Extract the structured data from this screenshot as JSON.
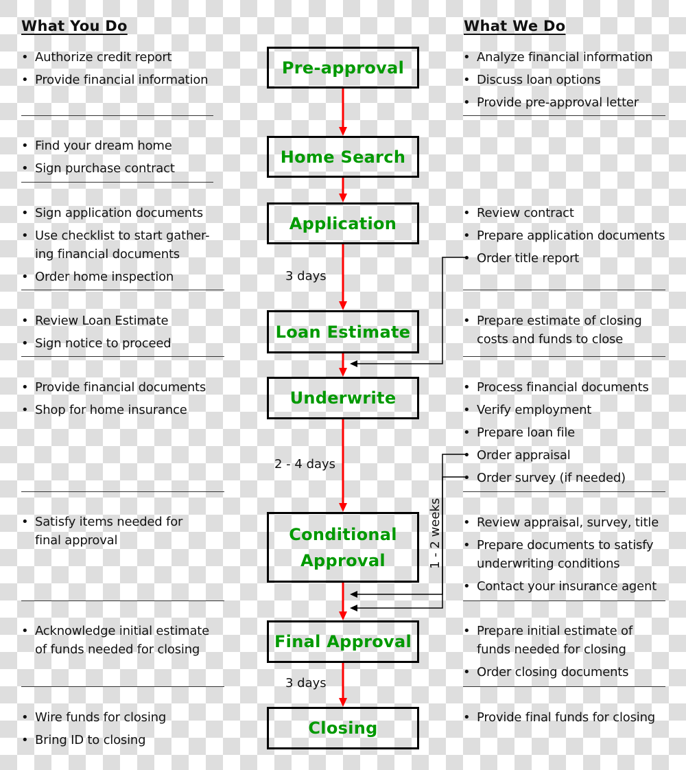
{
  "headings": {
    "you": "What You Do",
    "we": "What We Do"
  },
  "steps": [
    {
      "label": "Pre-approval"
    },
    {
      "label": "Home Search"
    },
    {
      "label": "Application"
    },
    {
      "label": "Loan Estimate"
    },
    {
      "label": "Underwrite"
    },
    {
      "label": "Conditional Approval"
    },
    {
      "label": "Final Approval"
    },
    {
      "label": "Closing"
    }
  ],
  "durations": {
    "application_to_estimate": "3 days",
    "underwrite_to_conditional": "2 - 4 days",
    "appraisal_window": "1 - 2 weeks",
    "final_to_closing": "3 days"
  },
  "you_do": [
    [
      "Authorize credit report",
      "Provide financial information"
    ],
    [
      "Find your dream home",
      "Sign purchase contract"
    ],
    [
      "Sign application documents",
      "Use checklist to start gather-\ning financial documents",
      "Order home inspection"
    ],
    [
      "Review Loan Estimate",
      "Sign notice to proceed"
    ],
    [
      "Provide financial documents",
      "Shop for home insurance"
    ],
    [
      "Satisfy items needed for\nfinal approval"
    ],
    [
      "Acknowledge initial estimate\nof funds needed for closing"
    ],
    [
      "Wire funds for closing",
      "Bring ID to closing"
    ]
  ],
  "we_do": [
    [
      "Analyze financial information",
      "Discuss loan options",
      "Provide pre-approval letter"
    ],
    [],
    [
      "Review contract",
      "Prepare application documents",
      "Order title report"
    ],
    [
      "Prepare estimate of closing\ncosts and funds to close"
    ],
    [
      "Process financial documents",
      "Verify employment",
      "Prepare loan file",
      "Order appraisal",
      "Order survey (if needed)"
    ],
    [
      "Review appraisal, survey, title",
      "Prepare documents to satisfy\nunderwriting conditions",
      "Contact your insurance agent"
    ],
    [
      "Prepare initial estimate of\nfunds needed for closing",
      "Order closing documents"
    ],
    [
      "Provide final funds for closing"
    ]
  ],
  "colors": {
    "step_text": "#009900",
    "flow_arrow": "#ff0000",
    "connector": "#000000"
  }
}
